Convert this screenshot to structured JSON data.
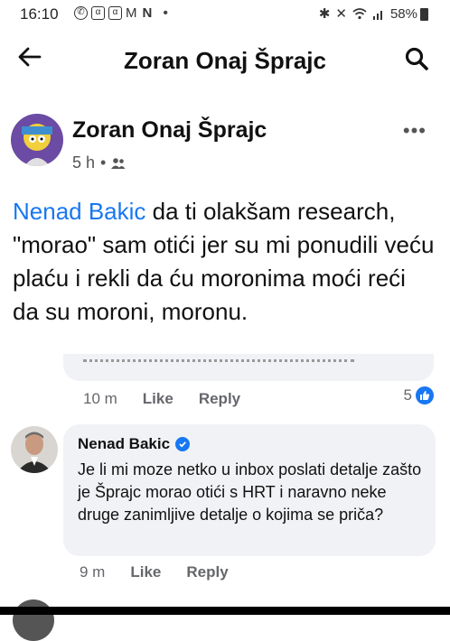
{
  "status_bar": {
    "time": "16:10",
    "letter_n": "N",
    "battery": "58%",
    "left_icons": [
      "whatsapp-icon",
      "app-alpha-icon",
      "app-alpha-icon",
      "gmail-icon",
      "n-icon",
      "dot-icon"
    ],
    "right_icons": [
      "bluetooth-icon",
      "mute-icon",
      "wifi-icon",
      "signal-icon",
      "battery-icon"
    ]
  },
  "app_bar": {
    "title": "Zoran Onaj Šprajc"
  },
  "post": {
    "author": "Zoran Onaj Šprajc",
    "time": "5 h",
    "separator": "•",
    "mention": "Nenad Bakic",
    "text": " da ti olakšam research, \"morao\" sam otići jer su mi ponudili veću plaću i rekli da ću moronima moći reći da su moroni, moronu."
  },
  "prev_comment": {
    "time": "10 m",
    "like": "Like",
    "reply": "Reply",
    "reaction_count": "5"
  },
  "comment": {
    "author": "Nenad Bakic",
    "text": "Je li mi moze netko u inbox poslati detalje zašto je Šprajc morao otići s HRT i naravno neke druge zanimljive detalje o kojima se priča?",
    "time": "9 m",
    "like": "Like",
    "reply": "Reply"
  },
  "colors": {
    "accent": "#1877f2",
    "bubble": "#f0f2f5",
    "muted": "#65676b"
  }
}
